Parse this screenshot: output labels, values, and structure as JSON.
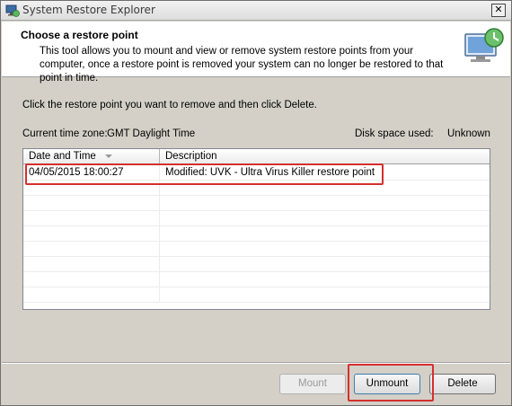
{
  "window": {
    "title": "System Restore Explorer",
    "close_label": "✕"
  },
  "header": {
    "title": "Choose a restore point",
    "description": "This tool allows you to mount and view or remove system restore points from your computer, once a restore point is removed your system can no longer be restored to that point in time."
  },
  "main": {
    "instruction": "Click the restore point you want to remove and then click Delete.",
    "timezone_label": "Current time zone:",
    "timezone_value": "GMT Daylight Time",
    "disk_label": "Disk space used:",
    "disk_value": "Unknown"
  },
  "table": {
    "columns": [
      "Date and Time",
      "Description"
    ],
    "rows": [
      [
        "04/05/2015 18:00:27",
        "Modified: UVK - Ultra Virus Killer restore point"
      ]
    ]
  },
  "buttons": {
    "mount": "Mount",
    "unmount": "Unmount",
    "delete": "Delete"
  },
  "colors": {
    "highlight": "#d4302f",
    "dialog_bg": "#d4d0c8"
  }
}
